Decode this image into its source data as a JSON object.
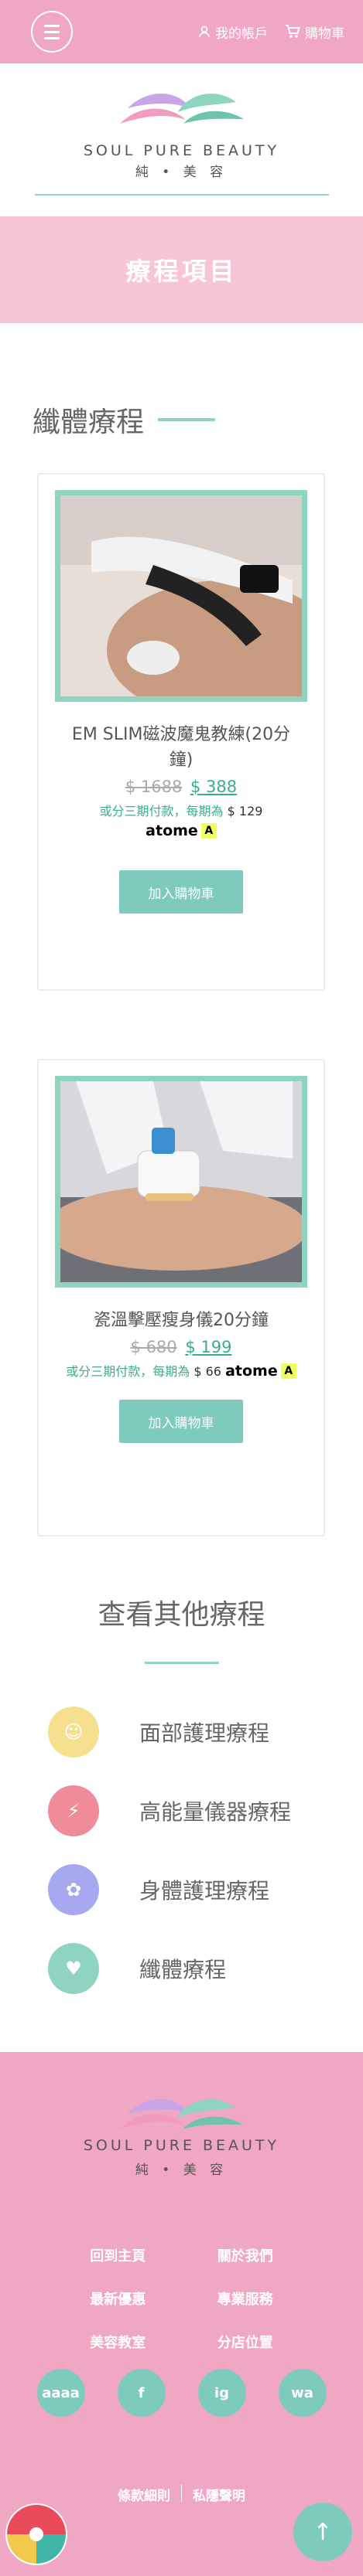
{
  "header": {
    "account_label": "我的帳戶",
    "cart_label": "購物車"
  },
  "brand": {
    "name": "SOUL PURE BEAUTY",
    "sub": "純 • 美 容"
  },
  "banner": {
    "title": "療程項目"
  },
  "section": {
    "title": "纖體療程"
  },
  "products": [
    {
      "name": "EM SLIM磁波魔鬼教練(20分鐘)",
      "old_price": "$ 1688",
      "new_price": "$ 388",
      "installment_text": "或分三期付款，每期為",
      "installment_amount": "$ 129",
      "provider": "atome",
      "button": "加入購物車"
    },
    {
      "name": "瓷溫擊壓瘦身儀20分鐘",
      "old_price": "$ 680",
      "new_price": "$ 199",
      "installment_text": "或分三期付款，每期為",
      "installment_amount": "$ 66",
      "provider": "atome",
      "button": "加入購物車"
    }
  ],
  "other": {
    "title": "查看其他療程",
    "categories": [
      {
        "label": "面部護理療程",
        "color": "#f5e08f"
      },
      {
        "label": "高能量儀器療程",
        "color": "#f08c9a"
      },
      {
        "label": "身體護理療程",
        "color": "#a6a8f0"
      },
      {
        "label": "纖體療程",
        "color": "#8fd3c1"
      }
    ]
  },
  "footer": {
    "links": [
      "回到主頁",
      "關於我們",
      "最新優惠",
      "專業服務",
      "美容教室",
      "分店位置"
    ],
    "socials": [
      "aaaa",
      "f",
      "ig",
      "wa"
    ],
    "bottom_links": [
      "條款細則",
      "私隱聲明"
    ]
  }
}
